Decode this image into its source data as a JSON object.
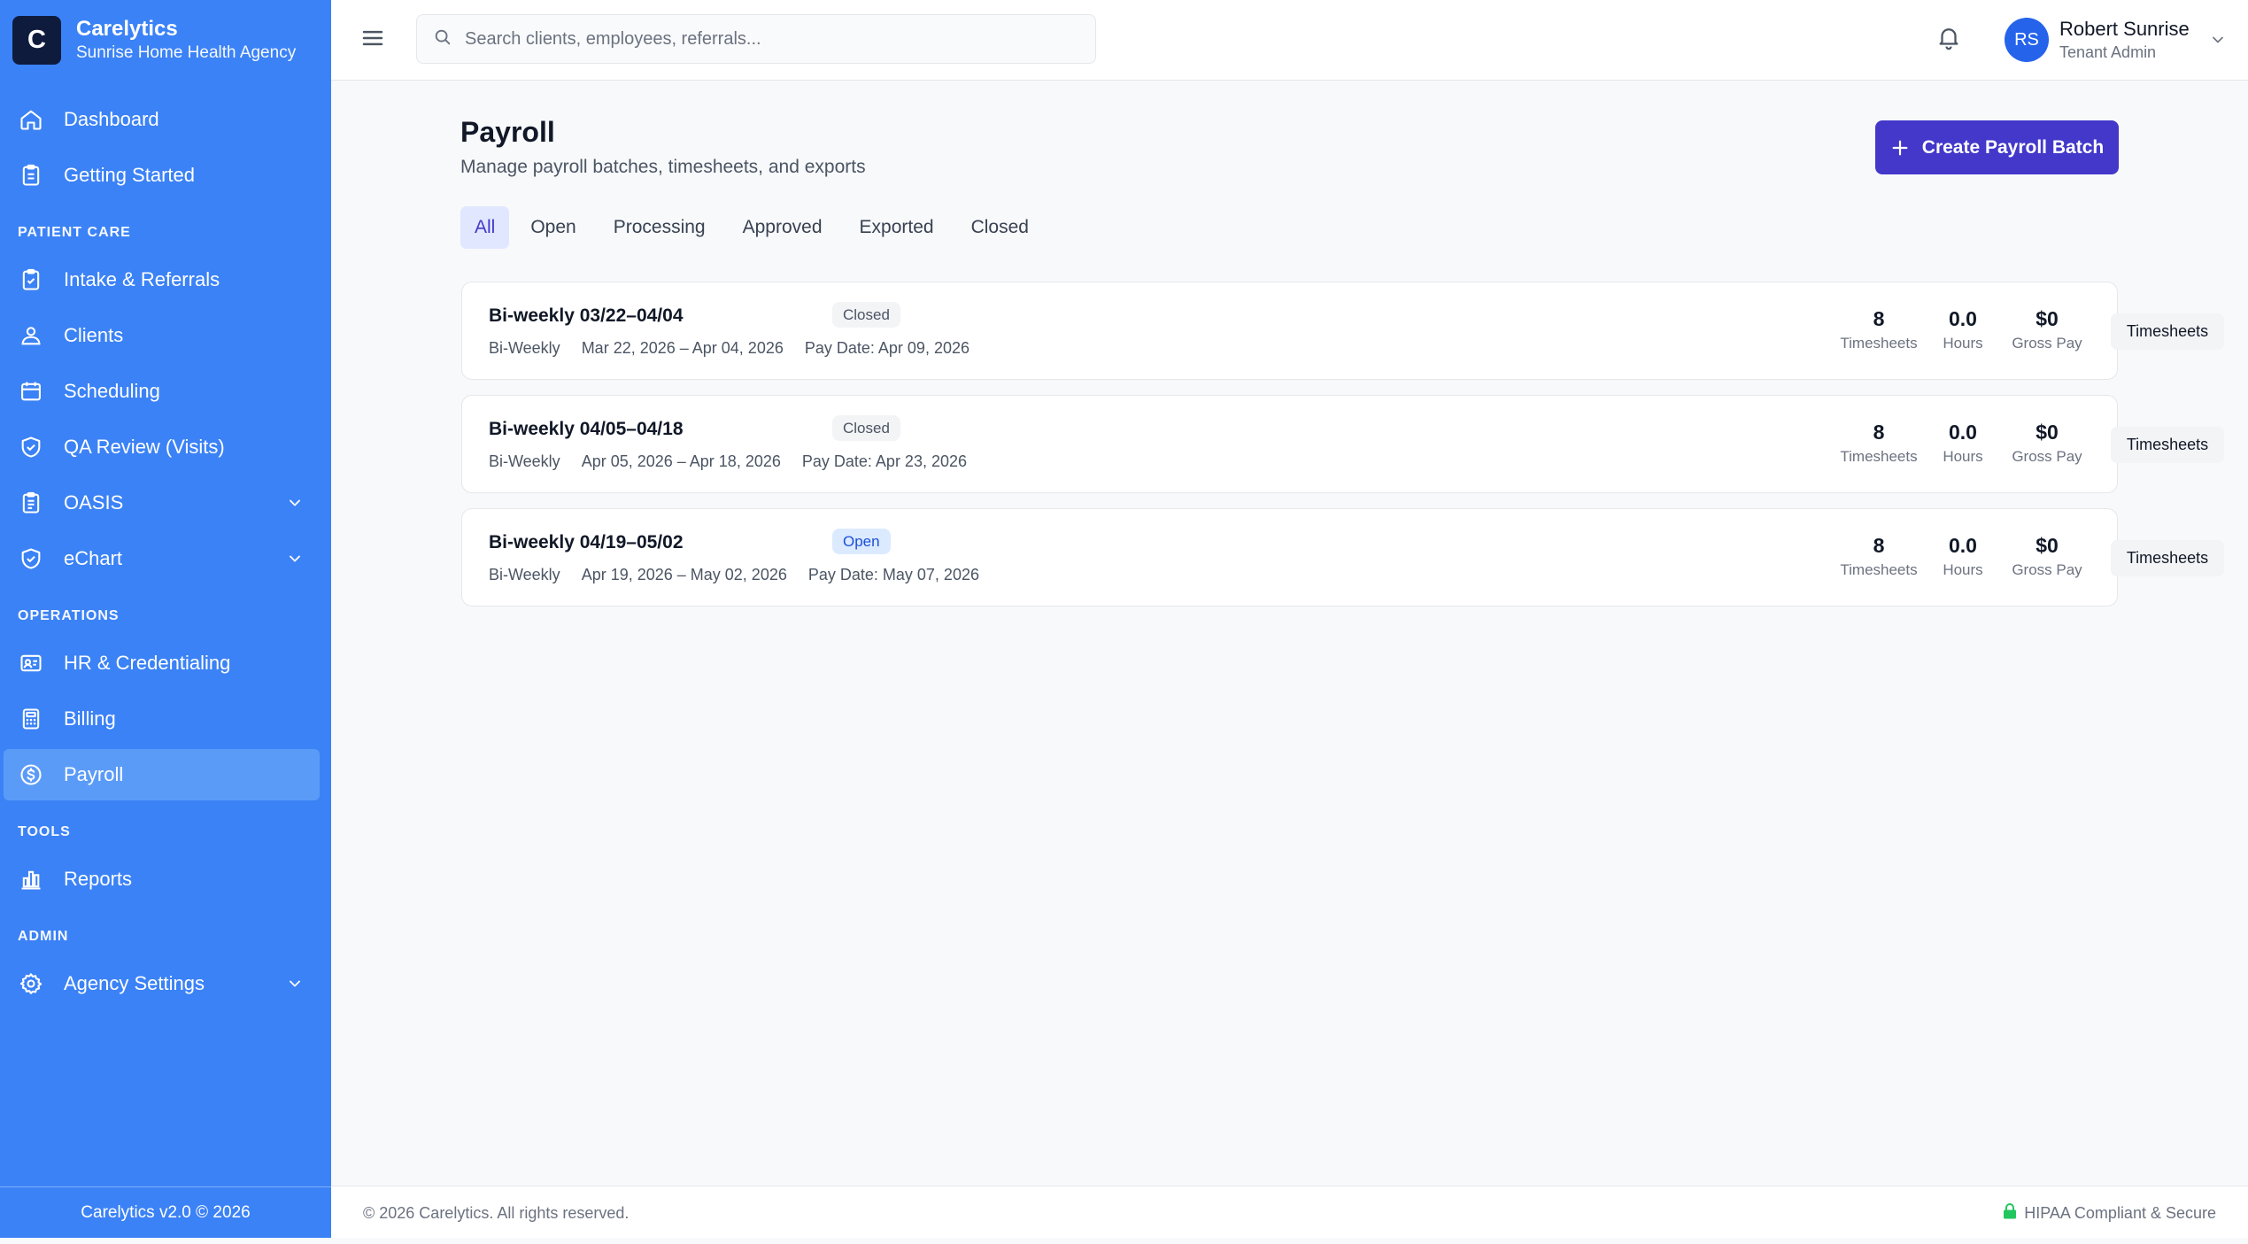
{
  "brand": {
    "logo_letter": "C",
    "name": "Carelytics",
    "agency": "Sunrise Home Health Agency"
  },
  "sidebar": {
    "items": [
      {
        "label": "Dashboard",
        "icon": "home-icon"
      },
      {
        "label": "Getting Started",
        "icon": "clipboard-icon"
      },
      {
        "label": "Intake & Referrals",
        "icon": "clipboard-check-icon"
      },
      {
        "label": "Clients",
        "icon": "users-icon"
      },
      {
        "label": "Scheduling",
        "icon": "calendar-icon"
      },
      {
        "label": "QA Review (Visits)",
        "icon": "shield-check-icon"
      },
      {
        "label": "OASIS",
        "icon": "clipboard-list-icon"
      },
      {
        "label": "eChart",
        "icon": "shield-check-icon"
      },
      {
        "label": "HR & Credentialing",
        "icon": "id-card-icon"
      },
      {
        "label": "Billing",
        "icon": "calculator-icon"
      },
      {
        "label": "Payroll",
        "icon": "dollar-circle-icon"
      },
      {
        "label": "Reports",
        "icon": "bar-chart-icon"
      },
      {
        "label": "Agency Settings",
        "icon": "gear-icon"
      }
    ],
    "sections": [
      "PATIENT CARE",
      "OPERATIONS",
      "TOOLS",
      "ADMIN"
    ],
    "active": "Payroll",
    "footer": "Carelytics v2.0 © 2026"
  },
  "header": {
    "search_placeholder": "Search clients, employees, referrals...",
    "user": {
      "initials": "RS",
      "name": "Robert Sunrise",
      "role": "Tenant Admin"
    }
  },
  "page": {
    "title": "Payroll",
    "subtitle": "Manage payroll batches, timesheets, and exports",
    "create_button": "Create Payroll Batch",
    "tabs": [
      "All",
      "Open",
      "Processing",
      "Approved",
      "Exported",
      "Closed"
    ],
    "active_tab": "All"
  },
  "batches": [
    {
      "title": "Bi-weekly 03/22–04/04",
      "status": "Closed",
      "frequency": "Bi-Weekly",
      "period": "Mar 22, 2026 – Apr 04, 2026",
      "pay_date": "Pay Date: Apr 09, 2026",
      "timesheets": "8",
      "hours": "0.0",
      "gross_pay": "$0"
    },
    {
      "title": "Bi-weekly 04/05–04/18",
      "status": "Closed",
      "frequency": "Bi-Weekly",
      "period": "Apr 05, 2026 – Apr 18, 2026",
      "pay_date": "Pay Date: Apr 23, 2026",
      "timesheets": "8",
      "hours": "0.0",
      "gross_pay": "$0"
    },
    {
      "title": "Bi-weekly 04/19–05/02",
      "status": "Open",
      "frequency": "Bi-Weekly",
      "period": "Apr 19, 2026 – May 02, 2026",
      "pay_date": "Pay Date: May 07, 2026",
      "timesheets": "8",
      "hours": "0.0",
      "gross_pay": "$0"
    }
  ],
  "labels": {
    "timesheets": "Timesheets",
    "hours": "Hours",
    "gross_pay": "Gross Pay",
    "timesheets_button": "Timesheets"
  },
  "footer": {
    "copyright": "© 2026 Carelytics. All rights reserved.",
    "compliance": "HIPAA Compliant & Secure"
  },
  "colors": {
    "sidebar": "#3b82f6",
    "primary_button": "#4338ca",
    "active_tab_bg": "#e0e7ff",
    "hipaa_lock": "#22c55e"
  }
}
